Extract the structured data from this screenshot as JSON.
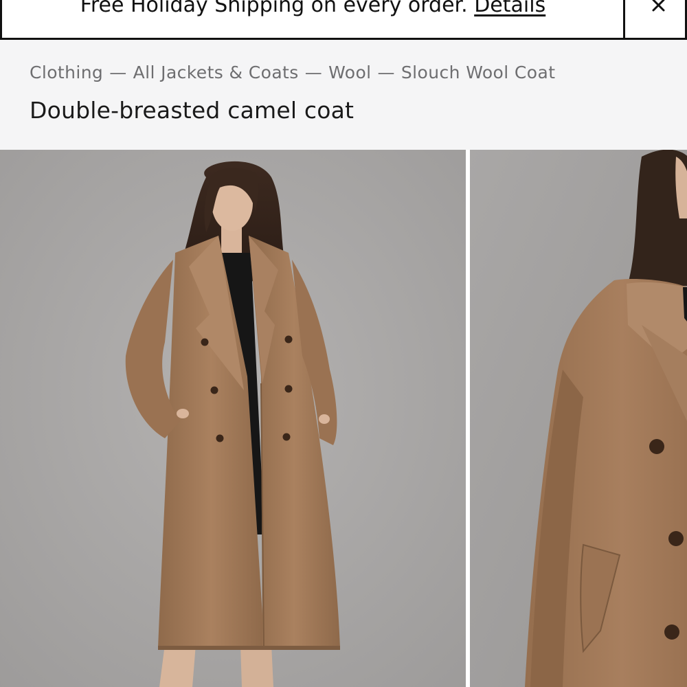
{
  "promo": {
    "text": "Free Holiday Shipping on every order.",
    "link_label": "Details",
    "close_icon": "close-icon"
  },
  "breadcrumb": {
    "items": [
      "Clothing",
      "All Jackets & Coats",
      "Wool",
      "Slouch Wool Coat"
    ],
    "separator": "—"
  },
  "product": {
    "title": "Double-breasted camel coat"
  },
  "gallery": {
    "images": [
      {
        "alt": "model-full-length-photo"
      },
      {
        "alt": "model-closeup-photo"
      }
    ]
  },
  "colors": {
    "banner_border": "#111111",
    "header_bg": "#f5f5f6",
    "breadcrumb_text": "#6e6e70",
    "title_text": "#1a1a1a",
    "coat": "#a27a59",
    "photo_bg": "#a8a6a5"
  }
}
